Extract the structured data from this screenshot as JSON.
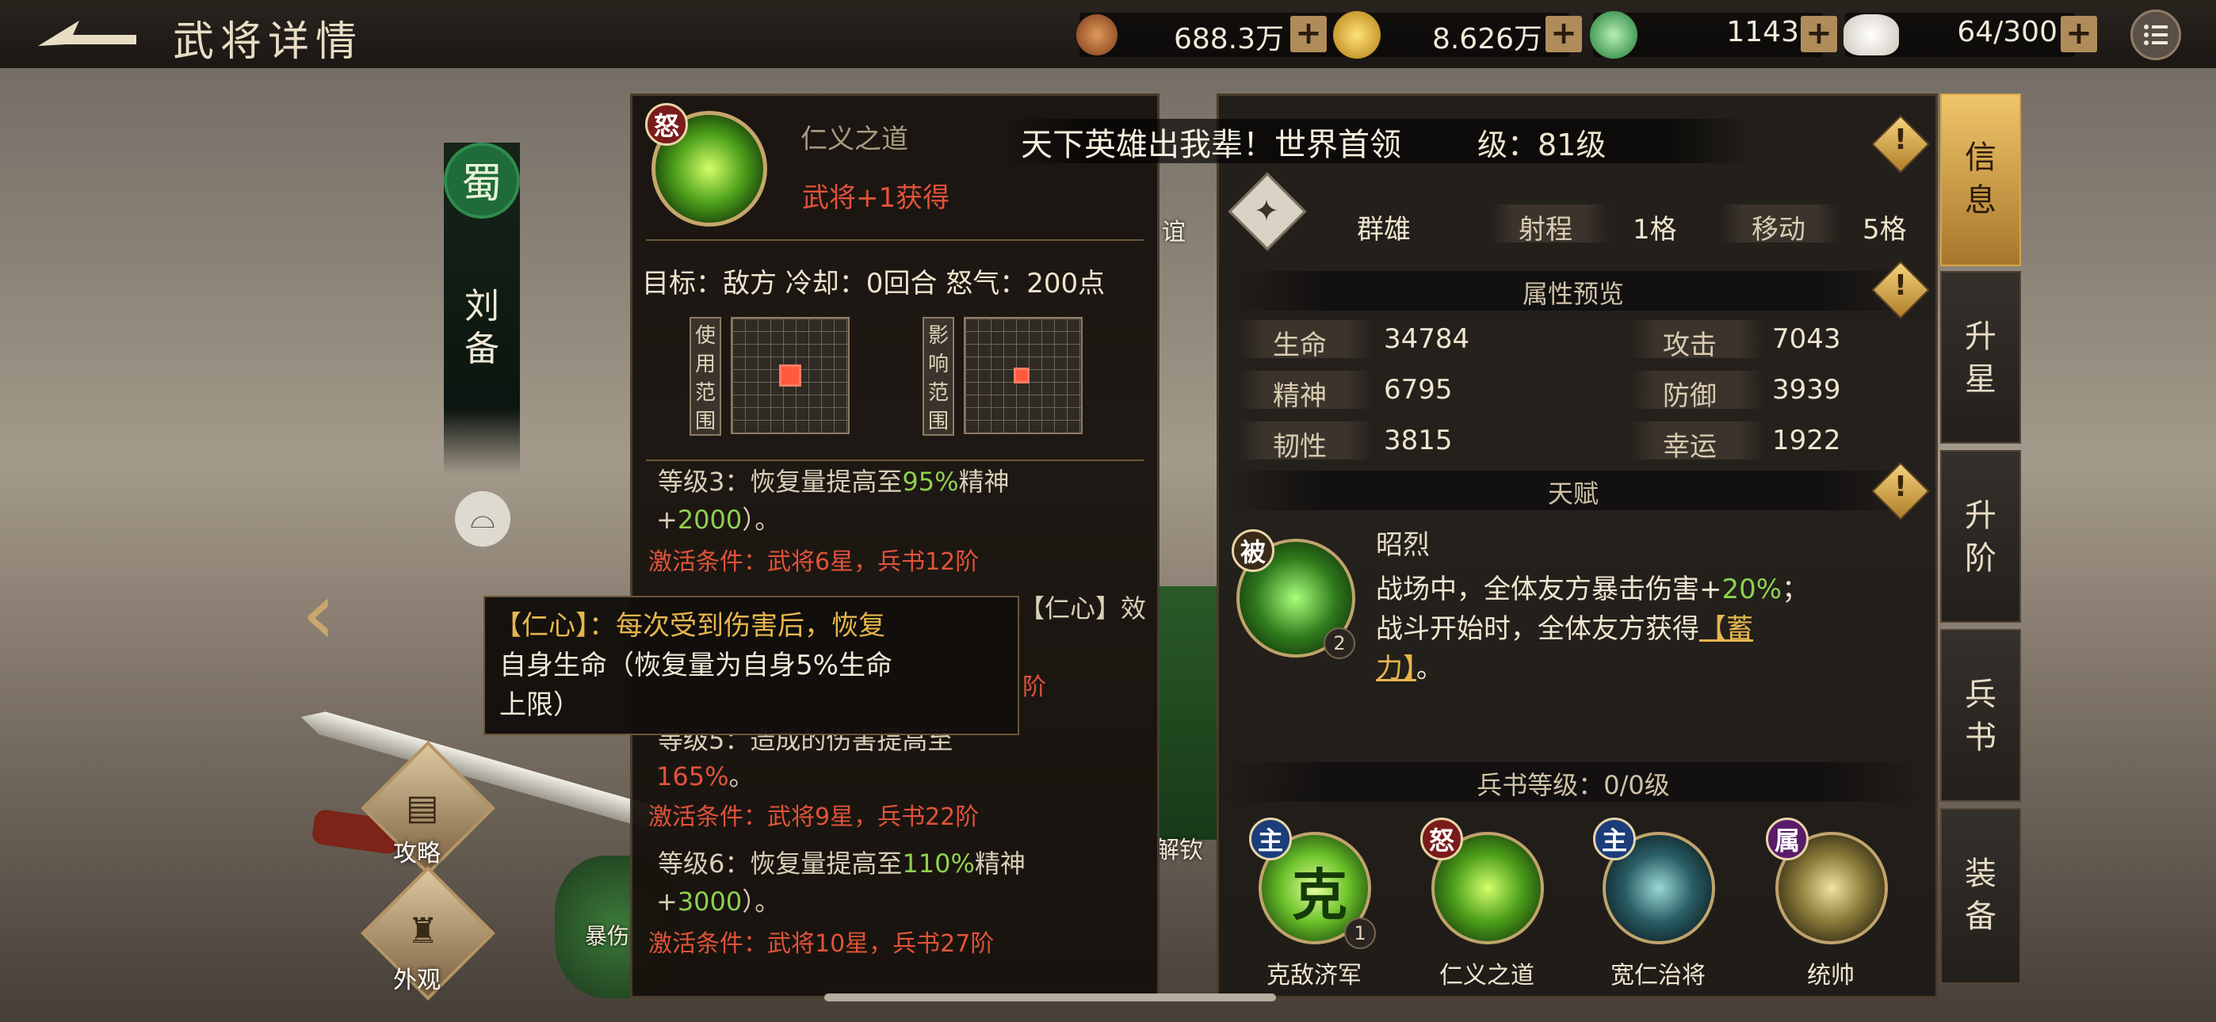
{
  "header": {
    "title": "武将详情"
  },
  "resources": [
    {
      "name": "copper-coins",
      "value": "688.3万",
      "color": "#b86a3a"
    },
    {
      "name": "gold-coin",
      "value": "8.626万",
      "color": "#e5b62a"
    },
    {
      "name": "jade-coin",
      "value": "1143",
      "color": "#3aa45a"
    },
    {
      "name": "stamina-bun",
      "value": "64/300",
      "color": "#efe9e1"
    }
  ],
  "plus_label": "+",
  "menu_icon": "list-icon",
  "hero": {
    "faction_glyph": "蜀",
    "name": "刘备"
  },
  "side_buttons": [
    {
      "label": "攻略"
    },
    {
      "label": "外观"
    }
  ],
  "background_fragments": [
    "谊",
    "解钦",
    "暴伤"
  ],
  "skill_detail": {
    "badge": "怒",
    "name": "仁义之道",
    "subtitle": "武将+1获得",
    "target_line": "目标：敌方 冷却：0回合 怒气：200点",
    "use_range_label": "使用范围",
    "effect_range_label": "影响范围",
    "lines": [
      {
        "text": "等级3：恢复量提高至",
        "hl": "95%",
        "tail": "精神"
      },
      {
        "text": "+",
        "hl": "2000",
        "tail": "）。"
      },
      {
        "text": "激活条件：武将6星，兵书12阶",
        "red": true
      },
      {
        "text": "【仁心】效",
        "partial": true
      },
      {
        "text": "阶",
        "partial": true
      },
      {
        "text": "等级5：造成的伤害提高至",
        "partial": true
      },
      {
        "text": "",
        "hl_red": "165%",
        "tail": "。"
      },
      {
        "text": "激活条件：武将9星，兵书22阶",
        "red": true
      },
      {
        "text": "等级6：恢复量提高至",
        "hl": "110%",
        "tail": "精神"
      },
      {
        "text": "+",
        "hl": "3000",
        "tail": "）。"
      },
      {
        "text": "激活条件：武将10星，兵书27阶",
        "red": true
      }
    ]
  },
  "tooltip": {
    "lines": [
      "【仁心】：每次受到伤害后，恢复",
      "自身生命（恢复量为自身5%生命",
      "上限）"
    ]
  },
  "info": {
    "marquee": "天下英雄出我辈！世界首领",
    "level_label": "级：81级",
    "camp": "群雄",
    "range_label": "射程",
    "range_value": "1格",
    "move_label": "移动",
    "move_value": "5格",
    "attr_title": "属性预览",
    "attrs": [
      {
        "label": "生命",
        "value": "34784"
      },
      {
        "label": "攻击",
        "value": "7043"
      },
      {
        "label": "精神",
        "value": "6795"
      },
      {
        "label": "防御",
        "value": "3939"
      },
      {
        "label": "韧性",
        "value": "3815"
      },
      {
        "label": "幸运",
        "value": "1922"
      }
    ],
    "talent_title": "天赋",
    "talent": {
      "badge": "被",
      "level": "2",
      "name": "昭烈",
      "desc1_a": "战场中，全体友方暴击伤害+",
      "desc1_hl": "20%",
      "desc1_b": "；",
      "desc2_a": "战斗开始时，全体友方获得",
      "desc2_hl": "【蓄",
      "desc3_hl": "力】",
      "desc3_b": "。"
    },
    "book_title": "兵书等级：0/0级",
    "skills": [
      {
        "badge": "主",
        "label": "克敌济军",
        "glyph": "克",
        "level": "1",
        "badge_color": "#1b3d7a"
      },
      {
        "badge": "怒",
        "label": "仁义之道",
        "badge_color": "#7a1b1b"
      },
      {
        "badge": "主",
        "label": "宽仁治将",
        "badge_color": "#1b3d7a"
      },
      {
        "badge": "属",
        "label": "统帅",
        "badge_color": "#5a1b6a"
      }
    ]
  },
  "tabs": [
    {
      "label": "信息",
      "active": true
    },
    {
      "label": "升星"
    },
    {
      "label": "升阶"
    },
    {
      "label": "兵书"
    },
    {
      "label": "装备"
    }
  ]
}
